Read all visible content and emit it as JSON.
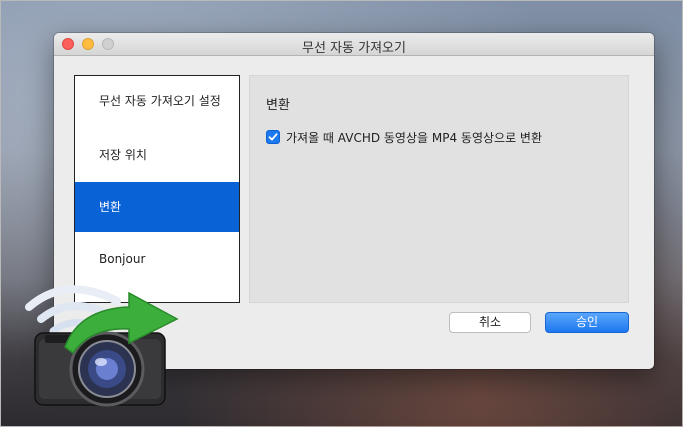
{
  "window": {
    "title": "무선 자동 가져오기"
  },
  "sidebar": {
    "items": [
      {
        "label": "무선 자동 가져오기 설정",
        "selected": false
      },
      {
        "label": "저장 위치",
        "selected": false
      },
      {
        "label": "변환",
        "selected": true
      },
      {
        "label": "Bonjour",
        "selected": false
      }
    ]
  },
  "panel": {
    "title": "변환",
    "checkbox": {
      "label": "가져올 때 AVCHD 동영상을 MP4 동영상으로 변환",
      "checked": true
    }
  },
  "buttons": {
    "cancel_label": "취소",
    "ok_label": "승인"
  },
  "colors": {
    "selection": "#0a63d6",
    "accent_button": "#1c78f0",
    "arrow_green": "#3cae3c"
  },
  "icons": {
    "app_logo": "wireless-camera-import-icon"
  }
}
